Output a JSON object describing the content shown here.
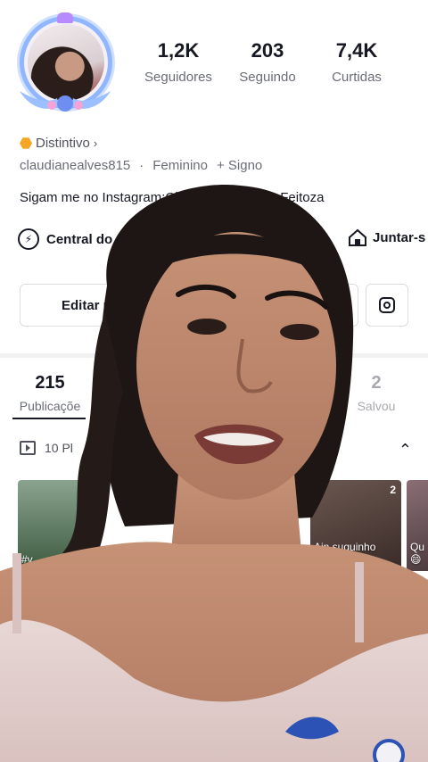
{
  "profile": {
    "stats": [
      {
        "value": "1,2K",
        "label": "Seguidores"
      },
      {
        "value": "203",
        "label": "Seguindo"
      },
      {
        "value": "7,4K",
        "label": "Curtidas"
      }
    ],
    "badge_label": "Distintivo",
    "username": "claudianealves815",
    "gender": "Feminino",
    "sign_label": "+ Signo",
    "bio": "Sigam me no Instagram:Cla",
    "bio_tail": "Feitoza"
  },
  "links": {
    "creator_center": "Central do Cri",
    "join": "Juntar-s"
  },
  "buttons": {
    "edit_profile": "Editar p"
  },
  "tabs": [
    {
      "count": "215",
      "label": "Publicaçõe"
    },
    {
      "count": "2",
      "label": "Salvou"
    }
  ],
  "playlist": {
    "label": "10 Pl"
  },
  "thumbnails": [
    {
      "caption": "#v",
      "count": ""
    },
    {
      "caption": "Ain suquinho\nmuruncuj...",
      "count": "2"
    },
    {
      "caption": "Qu\n😄",
      "count": ""
    }
  ],
  "colors": {
    "accent_badge": "#f5a623",
    "avatar_ring": "#8fb6ff",
    "text_primary": "#161823",
    "text_secondary": "#6b6d76"
  }
}
